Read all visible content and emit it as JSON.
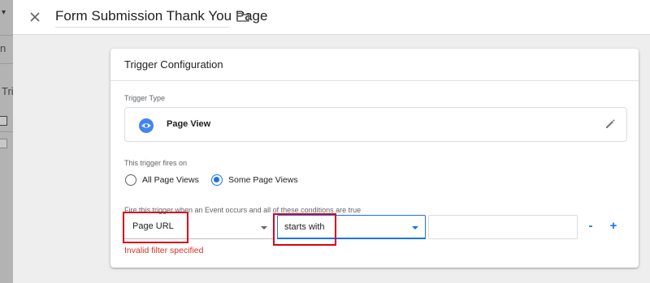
{
  "background": {
    "left_panel_fragments": {
      "top_fragment": "n",
      "list_fragment": "Trig"
    }
  },
  "header": {
    "title": "Form Submission Thank You Page",
    "icons": {
      "close": "close-icon",
      "folder": "folder-icon"
    }
  },
  "trigger_configuration": {
    "heading": "Trigger Configuration",
    "trigger_type": {
      "label": "Trigger Type",
      "name": "Page View",
      "icon": "eye-icon",
      "edit_icon": "pencil-icon"
    },
    "fires_on": {
      "label": "This trigger fires on",
      "options": [
        {
          "label": "All Page Views",
          "selected": false
        },
        {
          "label": "Some Page Views",
          "selected": true
        }
      ]
    },
    "condition": {
      "label": "Fire this trigger when an Event occurs and all of these conditions are true",
      "variable": "Page URL",
      "operator": "starts with",
      "value": "",
      "remove_label": "-",
      "add_label": "+",
      "error": "Invalid filter specified"
    }
  },
  "colors": {
    "accent": "#1a73e8",
    "error": "#d93025",
    "highlight_outline": "#d9001b",
    "eye_icon": "#4285f4"
  }
}
